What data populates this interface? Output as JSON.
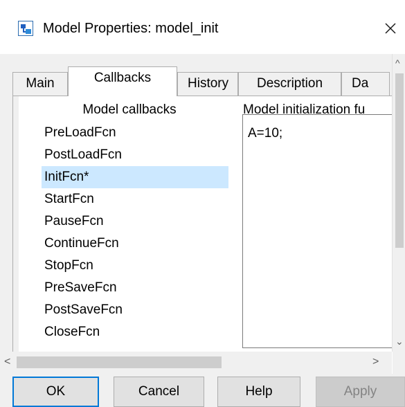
{
  "window": {
    "title": "Model Properties: model_init",
    "icon": "simulink-model-icon",
    "close_glyph": "×"
  },
  "tabs": [
    {
      "label": "Main",
      "active": false
    },
    {
      "label": "Callbacks",
      "active": true
    },
    {
      "label": "History",
      "active": false
    },
    {
      "label": "Description",
      "active": false
    },
    {
      "label": "Da",
      "active": false
    }
  ],
  "callbacks": {
    "header": "Model callbacks",
    "items": [
      {
        "label": "PreLoadFcn",
        "selected": false
      },
      {
        "label": "PostLoadFcn",
        "selected": false
      },
      {
        "label": "InitFcn*",
        "selected": true
      },
      {
        "label": "StartFcn",
        "selected": false
      },
      {
        "label": "PauseFcn",
        "selected": false
      },
      {
        "label": "ContinueFcn",
        "selected": false
      },
      {
        "label": "StopFcn",
        "selected": false
      },
      {
        "label": "PreSaveFcn",
        "selected": false
      },
      {
        "label": "PostSaveFcn",
        "selected": false
      },
      {
        "label": "CloseFcn",
        "selected": false
      }
    ],
    "selected_color": "#cce8ff"
  },
  "editor": {
    "label": "Model initialization fu",
    "value": "A=10;"
  },
  "scrollbars": {
    "up": "^",
    "down": "⌄",
    "left": "<",
    "right": ">"
  },
  "buttons": {
    "ok": "OK",
    "cancel": "Cancel",
    "help": "Help",
    "apply": "Apply"
  },
  "colors": {
    "focus_border": "#0078d7",
    "disabled_text": "#838383"
  }
}
